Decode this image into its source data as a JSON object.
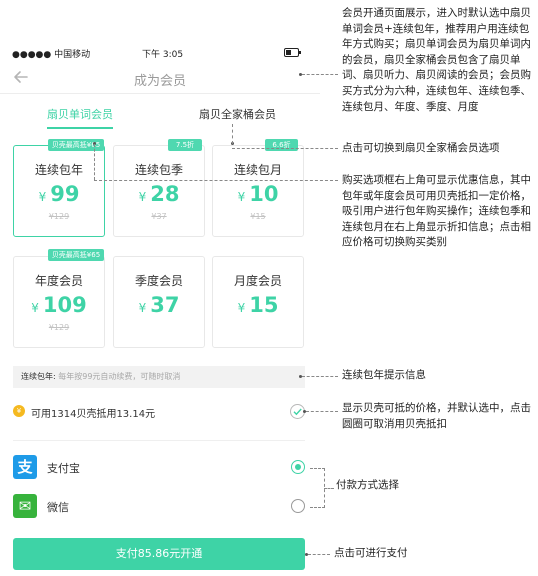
{
  "status_bar": {
    "carrier": "●●●●● 中国移动",
    "time": "下午 3:05"
  },
  "nav": {
    "title": "成为会员"
  },
  "tabs": [
    {
      "label": "扇贝单词会员",
      "active": true
    },
    {
      "label": "扇贝全家桶会员",
      "active": false
    }
  ],
  "plans": [
    {
      "name": "连续包年",
      "currency": "¥",
      "price": "99",
      "original": "¥129",
      "badge": "贝壳最高抵¥65",
      "selected": true
    },
    {
      "name": "连续包季",
      "currency": "¥",
      "price": "28",
      "original": "¥37",
      "badge": "7.5折",
      "selected": false
    },
    {
      "name": "连续包月",
      "currency": "¥",
      "price": "10",
      "original": "¥15",
      "badge": "6.6折",
      "selected": false
    },
    {
      "name": "年度会员",
      "currency": "¥",
      "price": "109",
      "original": "¥129",
      "badge": "贝壳最高抵¥65",
      "selected": false
    },
    {
      "name": "季度会员",
      "currency": "¥",
      "price": "37",
      "original": "",
      "badge": "",
      "selected": false
    },
    {
      "name": "月度会员",
      "currency": "¥",
      "price": "15",
      "original": "",
      "badge": "",
      "selected": false
    }
  ],
  "auto_renew_hint": {
    "label": "连续包年:",
    "text": "每年按99元自动续费，可随时取消"
  },
  "coin_deduction": {
    "coin_symbol": "¥",
    "text": "可用1314贝壳抵用13.14元",
    "checked": true
  },
  "payment_methods": [
    {
      "label": "支付宝",
      "icon": "alipay-icon",
      "icon_glyph": "支",
      "selected": true
    },
    {
      "label": "微信",
      "icon": "wechat-icon",
      "icon_glyph": "✉",
      "selected": false
    }
  ],
  "pay_button": {
    "label": "支付85.86元开通"
  },
  "annotations": [
    "会员开通页面展示，进入时默认选中扇贝单词会员+连续包年，推荐用户用连续包年方式购买；扇贝单词会员为扇贝单词内的会员，扇贝全家桶会员包含了扇贝单词、扇贝听力、扇贝阅读的会员；会员购买方式分为六种，连续包年、连续包季、连续包月、年度、季度、月度",
    "点击可切换到扇贝全家桶会员选项",
    "购买选项框右上角可显示优惠信息，其中包年或年度会员可用贝壳抵扣一定价格，吸引用户进行包年购买操作；连续包季和连续包月在右上角显示折扣信息；点击相应价格可切换购买类别",
    "连续包年提示信息",
    "显示贝壳可抵的价格，并默认选中，点击圆圈可取消用贝壳抵扣",
    "付款方式选择",
    "点击可进行支付"
  ],
  "colors": {
    "accent": "#3ed3a6",
    "alipay": "#1e9be8",
    "wechat": "#37b33c",
    "coin": "#f5b920"
  }
}
